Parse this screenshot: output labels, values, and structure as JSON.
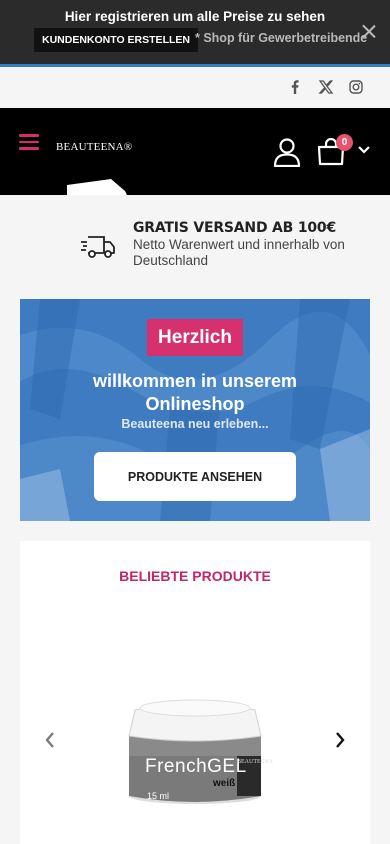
{
  "promo": {
    "title": "Hier registrieren um alle Preise zu sehen",
    "button_label": "KUNDENKONTO ERSTELLEN",
    "note": "* Shop für Gewerbetreibende"
  },
  "social": {
    "icons": [
      "facebook-icon",
      "x-icon",
      "instagram-icon"
    ]
  },
  "header": {
    "logo_text": "BEAUTEENA®",
    "cart_count": "0",
    "accent_color": "#d62b6e"
  },
  "shipping": {
    "title": "GRATIS VERSAND AB 100€",
    "text": "Netto Warenwert und innerhalb von Deutschland"
  },
  "hero": {
    "badge": "Herzlich",
    "title": "willkommen in unserem Onlineshop",
    "subtitle": "Beauteena neu erleben...",
    "button_label": "PRODUKTE ANSEHEN",
    "background_color": "#3f7cc1",
    "badge_color": "#d6306e"
  },
  "products": {
    "title": "BELIEBTE PRODUKTE",
    "title_color": "#c2266a",
    "product": {
      "name": "FrenchGEL",
      "variant": "weiß",
      "size": "15 ml",
      "brand": "BEAUTEENA"
    }
  }
}
